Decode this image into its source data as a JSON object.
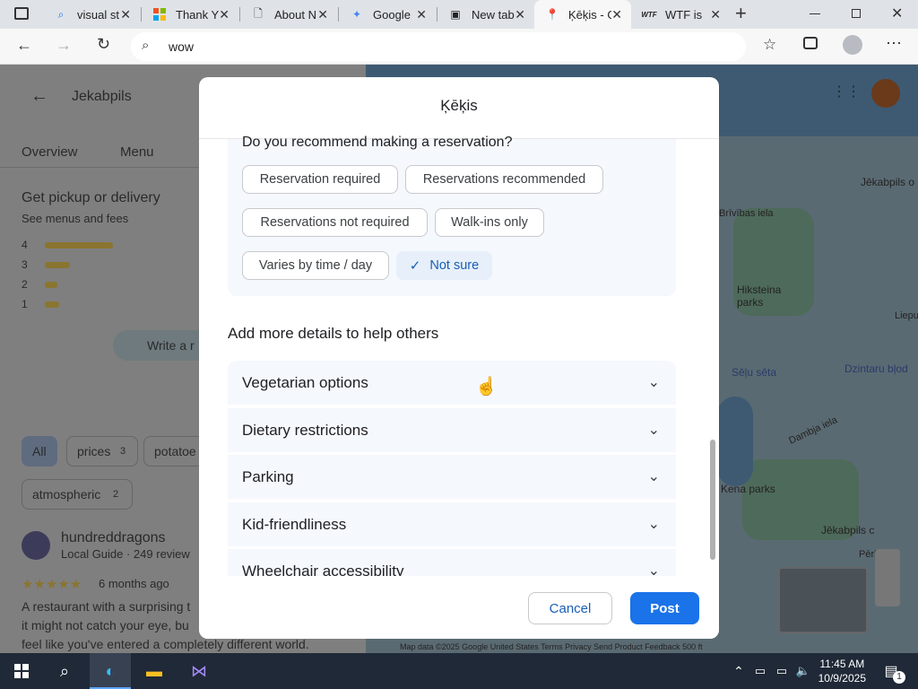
{
  "browser": {
    "tabs": [
      {
        "label": "visual st",
        "icon": "search-icon"
      },
      {
        "label": "Thank Y",
        "icon": "windows-logo-icon"
      },
      {
        "label": "About N",
        "icon": "document-icon"
      },
      {
        "label": "Google",
        "icon": "gemini-icon"
      },
      {
        "label": "New tab",
        "icon": "newtab-icon"
      },
      {
        "label": "Ķēķis - G",
        "icon": "maps-pin-icon"
      },
      {
        "label": "WTF is",
        "icon": "wtf-icon"
      }
    ],
    "address": "wow",
    "new_tab_symbol": "+"
  },
  "background": {
    "place": "Jekabpils",
    "tabs": [
      "Overview",
      "Menu"
    ],
    "pickup_title": "Get pickup or delivery",
    "pickup_sub": "See menus and fees",
    "rating_rows": [
      "4",
      "3",
      "2",
      "1"
    ],
    "write_review": "Write a r",
    "filters": [
      "All",
      "prices",
      "potatoe",
      "atmospheric"
    ],
    "filter_counts": [
      "3",
      "2"
    ],
    "reviewer": "hundreddragons",
    "reviewer_meta": "Local Guide · 249 review",
    "review_time": "6 months ago",
    "review_text": [
      "A restaurant with a surprising t",
      "it might not catch your eye, bu",
      "feel like you've entered a completely different world."
    ],
    "map_labels": [
      "Jēkabpils o",
      "Brīvības iela",
      "Hiksteina parks",
      "Sēļu sēta",
      "Dzintaru bļod",
      "Dambja iela",
      "Kena parks",
      "Jēkabpils c",
      "Liepu",
      "Pērļu"
    ],
    "map_footer": "Map data ©2025 Google   United States   Terms   Privacy   Send Product Feedback   500 ft"
  },
  "dialog": {
    "title": "Ķēķis",
    "reservation_question": "Do you recommend making a reservation?",
    "chips": [
      {
        "label": "Reservation required",
        "selected": false
      },
      {
        "label": "Reservations recommended",
        "selected": false
      },
      {
        "label": "Reservations not required",
        "selected": false
      },
      {
        "label": "Walk-ins only",
        "selected": false
      },
      {
        "label": "Varies by time / day",
        "selected": false
      },
      {
        "label": "Not sure",
        "selected": true
      }
    ],
    "section_title": "Add more details to help others",
    "accordion": [
      "Vegetarian options",
      "Dietary restrictions",
      "Parking",
      "Kid-friendliness",
      "Wheelchair accessibility"
    ],
    "cancel_label": "Cancel",
    "post_label": "Post"
  },
  "taskbar": {
    "time": "11:45 AM",
    "date": "10/9/2025",
    "notification_count": "1"
  }
}
